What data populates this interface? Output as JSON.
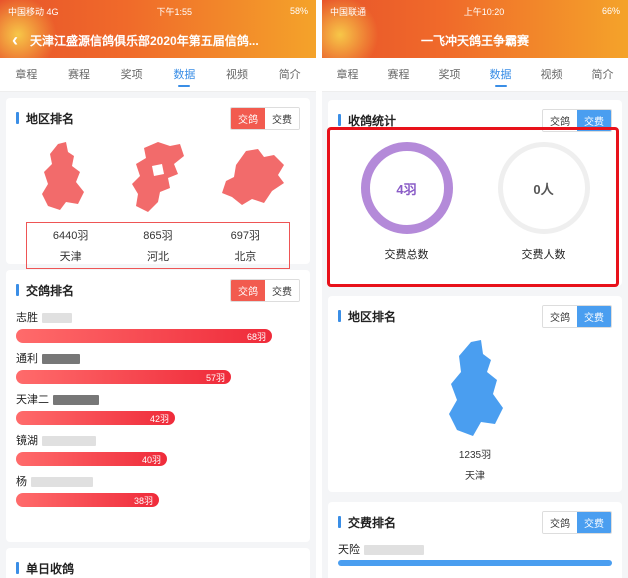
{
  "left": {
    "status": {
      "carrier": "中国移动 4G",
      "time": "下午1:55",
      "battery": "58%"
    },
    "title": "天津江盛源信鸽俱乐部2020年第五届信鸽...",
    "tabs": [
      "章程",
      "赛程",
      "奖项",
      "数据",
      "视频",
      "简介"
    ],
    "active_tab": "数据",
    "region_card": {
      "title": "地区排名",
      "seg": [
        "交鸽",
        "交费"
      ],
      "regions": [
        {
          "count": "6440羽",
          "name": "天津"
        },
        {
          "count": "865羽",
          "name": "河北"
        },
        {
          "count": "697羽",
          "name": "北京"
        }
      ]
    },
    "pigeon_card": {
      "title": "交鸽排名",
      "seg": [
        "交鸽",
        "交费"
      ],
      "rows": [
        {
          "name": "志胜",
          "value": "68羽",
          "fraction": 1.0
        },
        {
          "name": "通利",
          "value": "57羽",
          "fraction": 0.84
        },
        {
          "name": "天津二",
          "value": "42羽",
          "fraction": 0.62
        },
        {
          "name": "镜湖",
          "value": "40羽",
          "fraction": 0.59
        },
        {
          "name": "杨",
          "value": "38羽",
          "fraction": 0.56
        }
      ]
    },
    "daily_card": {
      "title": "单日收鸽"
    }
  },
  "right": {
    "status": {
      "carrier": "中国联通",
      "time": "上午10:20",
      "battery": "66%"
    },
    "title": "一飞冲天鸽王争霸赛",
    "tabs": [
      "章程",
      "赛程",
      "奖项",
      "数据",
      "视频",
      "简介"
    ],
    "active_tab": "数据",
    "collect_card": {
      "title": "收鸽统计",
      "seg": [
        "交鸽",
        "交费"
      ],
      "stats": [
        {
          "value": "4羽",
          "label": "交费总数",
          "color": "#8a5cc7"
        },
        {
          "value": "0人",
          "label": "交费人数",
          "color": "#555555"
        }
      ]
    },
    "region_card": {
      "title": "地区排名",
      "seg": [
        "交鸽",
        "交费"
      ],
      "region": {
        "count": "1235羽",
        "name": "天津"
      }
    },
    "fee_card": {
      "title": "交费排名",
      "seg": [
        "交鸽",
        "交费"
      ],
      "first_row": "天险"
    }
  },
  "colors": {
    "accent": "#3a8ee6",
    "red": "#f25b4f",
    "map_red": "#f26b6b",
    "map_blue": "#4a9ef0",
    "highlight": "#e8111a"
  }
}
